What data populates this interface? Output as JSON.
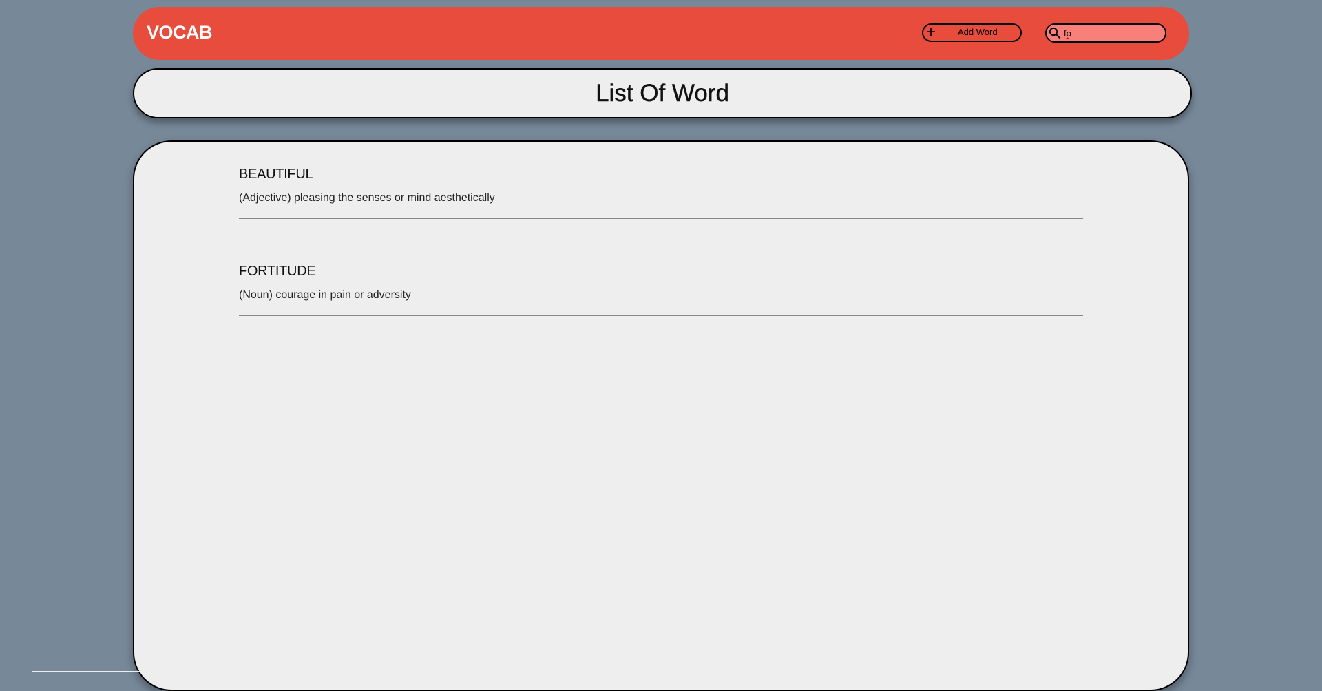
{
  "navbar": {
    "brand": "VOCAB",
    "add_button_label": "Add Word",
    "search_value": "fo"
  },
  "page_title": "List Of Word",
  "words": [
    {
      "word": "BEAUTIFUL",
      "definition": "(Adjective) pleasing the senses or mind aesthetically"
    },
    {
      "word": "FORTITUDE",
      "definition": "(Noun) courage in pain or adversity"
    }
  ],
  "colors": {
    "background": "#778899",
    "navbar": "#e74c3c",
    "card": "#eeeeee"
  }
}
